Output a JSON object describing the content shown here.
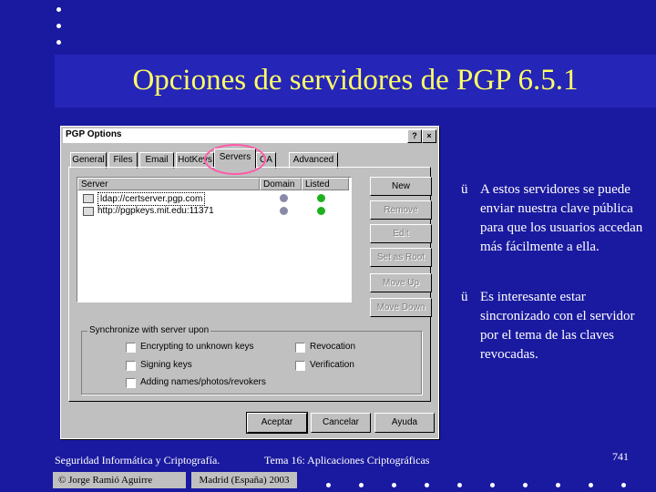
{
  "slide": {
    "title": "Opciones de servidores de PGP 6.5.1",
    "bullets": [
      "A estos servidores se puede enviar nuestra clave pública para que los usuarios accedan más fácilmente a ella.",
      "Es interesante estar sincronizado con el servidor por el tema de las claves revocadas."
    ],
    "check_glyph": "ü",
    "footer_left": "Seguridad Informática y Criptografía.",
    "footer_mid": "Tema 16: Aplicaciones Criptográficas",
    "page_number": "741",
    "author": "© Jorge Ramió Aguirre",
    "place": "Madrid (España) 2003"
  },
  "colors": {
    "background": "#1a1aa0",
    "title_band": "#2525b8",
    "title_text": "#ffff66",
    "highlight_ring": "#ff5aa8"
  },
  "dialog": {
    "title": "PGP Options",
    "help_glyph": "?",
    "close_glyph": "×",
    "tabs": [
      "General",
      "Files",
      "Email",
      "HotKeys",
      "Servers",
      "CA",
      "Advanced"
    ],
    "active_tab": "Servers",
    "list_headers": [
      "Server",
      "Domain",
      "Listed"
    ],
    "servers": [
      {
        "url": "ldap://certserver.pgp.com",
        "selected": true
      },
      {
        "url": "http://pgpkeys.mit.edu:11371",
        "selected": false
      }
    ],
    "side_buttons": [
      "New",
      "Remove",
      "Edit",
      "Set as Root",
      "Move Up",
      "Move Down"
    ],
    "sync_group": "Synchronize with server upon",
    "sync_options": [
      "Encrypting to unknown keys",
      "Signing keys",
      "Adding names/photos/revokers",
      "Revocation",
      "Verification"
    ],
    "buttons": [
      "Aceptar",
      "Cancelar",
      "Ayuda"
    ],
    "icons": [
      "server-icon",
      "domain-ball-icon",
      "listed-ball-icon"
    ]
  }
}
